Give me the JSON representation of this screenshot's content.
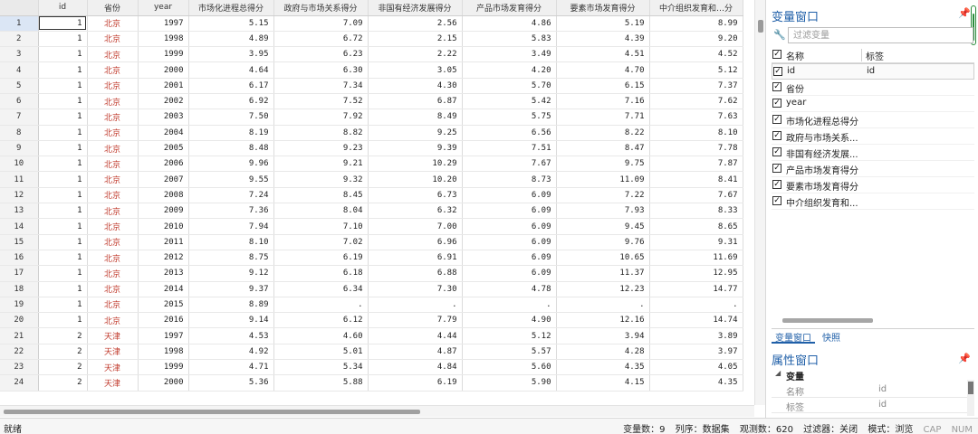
{
  "grid": {
    "columns": [
      "id",
      "省份",
      "year",
      "市场化进程总得分",
      "政府与市场关系得分",
      "非国有经济发展得分",
      "产品市场发育得分",
      "要素市场发育得分",
      "中介组织发育和…分"
    ],
    "rows": [
      [
        "1",
        "1",
        "北京",
        "1997",
        "5.15",
        "7.09",
        "2.56",
        "4.86",
        "5.19",
        "8.99"
      ],
      [
        "2",
        "1",
        "北京",
        "1998",
        "4.89",
        "6.72",
        "2.15",
        "5.83",
        "4.39",
        "9.20"
      ],
      [
        "3",
        "1",
        "北京",
        "1999",
        "3.95",
        "6.23",
        "2.22",
        "3.49",
        "4.51",
        "4.52"
      ],
      [
        "4",
        "1",
        "北京",
        "2000",
        "4.64",
        "6.30",
        "3.05",
        "4.20",
        "4.70",
        "5.12"
      ],
      [
        "5",
        "1",
        "北京",
        "2001",
        "6.17",
        "7.34",
        "4.30",
        "5.70",
        "6.15",
        "7.37"
      ],
      [
        "6",
        "1",
        "北京",
        "2002",
        "6.92",
        "7.52",
        "6.87",
        "5.42",
        "7.16",
        "7.62"
      ],
      [
        "7",
        "1",
        "北京",
        "2003",
        "7.50",
        "7.92",
        "8.49",
        "5.75",
        "7.71",
        "7.63"
      ],
      [
        "8",
        "1",
        "北京",
        "2004",
        "8.19",
        "8.82",
        "9.25",
        "6.56",
        "8.22",
        "8.10"
      ],
      [
        "9",
        "1",
        "北京",
        "2005",
        "8.48",
        "9.23",
        "9.39",
        "7.51",
        "8.47",
        "7.78"
      ],
      [
        "10",
        "1",
        "北京",
        "2006",
        "9.96",
        "9.21",
        "10.29",
        "7.67",
        "9.75",
        "7.87"
      ],
      [
        "11",
        "1",
        "北京",
        "2007",
        "9.55",
        "9.32",
        "10.20",
        "8.73",
        "11.09",
        "8.41"
      ],
      [
        "12",
        "1",
        "北京",
        "2008",
        "7.24",
        "8.45",
        "6.73",
        "6.09",
        "7.22",
        "7.67"
      ],
      [
        "13",
        "1",
        "北京",
        "2009",
        "7.36",
        "8.04",
        "6.32",
        "6.09",
        "7.93",
        "8.33"
      ],
      [
        "14",
        "1",
        "北京",
        "2010",
        "7.94",
        "7.10",
        "7.00",
        "6.09",
        "9.45",
        "8.65"
      ],
      [
        "15",
        "1",
        "北京",
        "2011",
        "8.10",
        "7.02",
        "6.96",
        "6.09",
        "9.76",
        "9.31"
      ],
      [
        "16",
        "1",
        "北京",
        "2012",
        "8.75",
        "6.19",
        "6.91",
        "6.09",
        "10.65",
        "11.69"
      ],
      [
        "17",
        "1",
        "北京",
        "2013",
        "9.12",
        "6.18",
        "6.88",
        "6.09",
        "11.37",
        "12.95"
      ],
      [
        "18",
        "1",
        "北京",
        "2014",
        "9.37",
        "6.34",
        "7.30",
        "4.78",
        "12.23",
        "14.77"
      ],
      [
        "19",
        "1",
        "北京",
        "2015",
        "8.89",
        ".",
        ".",
        ".",
        ".",
        "."
      ],
      [
        "20",
        "1",
        "北京",
        "2016",
        "9.14",
        "6.12",
        "7.79",
        "4.90",
        "12.16",
        "14.74"
      ],
      [
        "21",
        "2",
        "天津",
        "1997",
        "4.53",
        "4.60",
        "4.44",
        "5.12",
        "3.94",
        "3.89"
      ],
      [
        "22",
        "2",
        "天津",
        "1998",
        "4.92",
        "5.01",
        "4.87",
        "5.57",
        "4.28",
        "3.97"
      ],
      [
        "23",
        "2",
        "天津",
        "1999",
        "4.71",
        "5.34",
        "4.84",
        "5.60",
        "4.35",
        "4.05"
      ],
      [
        "24",
        "2",
        "天津",
        "2000",
        "5.36",
        "5.88",
        "6.19",
        "5.90",
        "4.15",
        "4.35"
      ]
    ]
  },
  "variables_panel": {
    "title": "变量窗口",
    "filter_placeholder": "过滤变量",
    "header_name": "名称",
    "header_label": "标签",
    "items": [
      {
        "name": "id",
        "label": "id"
      },
      {
        "name": "省份",
        "label": ""
      },
      {
        "name": "year",
        "label": ""
      },
      {
        "name": "市场化进程总得分",
        "label": ""
      },
      {
        "name": "政府与市场关系...",
        "label": ""
      },
      {
        "name": "非国有经济发展...",
        "label": ""
      },
      {
        "name": "产品市场发育得分",
        "label": ""
      },
      {
        "name": "要素市场发育得分",
        "label": ""
      },
      {
        "name": "中介组织发育和...",
        "label": ""
      }
    ],
    "check_glyph": "✓"
  },
  "tabs": {
    "variables": "变量窗口",
    "snapshots": "快照"
  },
  "properties_panel": {
    "title": "属性窗口",
    "group": "变量",
    "rows": [
      {
        "key": "名称",
        "value": "id"
      },
      {
        "key": "标签",
        "value": "id"
      }
    ]
  },
  "status": {
    "ready": "就绪",
    "var_count": "变量数：9",
    "order": "列序：数据集",
    "obs_count": "观测数：620",
    "filter": "过滤器：关闭",
    "mode": "模式：浏览",
    "cap": "CAP",
    "num": "NUM"
  },
  "colors": {
    "accent": "#1f5fa8",
    "province_text": "#c0392b"
  }
}
